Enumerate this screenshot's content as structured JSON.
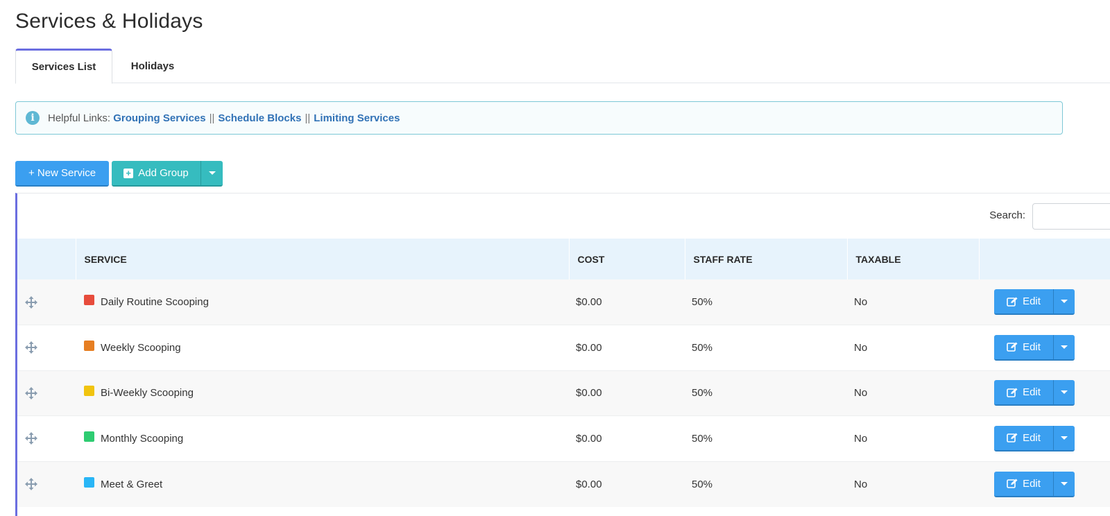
{
  "page": {
    "title": "Services & Holidays"
  },
  "tabs": [
    {
      "label": "Services List",
      "active": true
    },
    {
      "label": "Holidays",
      "active": false
    }
  ],
  "alert": {
    "prefix": "Helpful Links:",
    "links": [
      "Grouping Services",
      "Schedule Blocks",
      "Limiting Services"
    ],
    "separator": "||"
  },
  "toolbar": {
    "new_service_label": "+ New Service",
    "add_group_label": "Add Group"
  },
  "search": {
    "label": "Search:",
    "value": ""
  },
  "table": {
    "headers": [
      "",
      "SERVICE",
      "COST",
      "STAFF RATE",
      "TAXABLE",
      ""
    ],
    "rows": [
      {
        "name": "Daily Routine Scooping",
        "color": "#e74c3c",
        "cost": "$0.00",
        "staff_rate": "50%",
        "taxable": "No",
        "action": "Edit"
      },
      {
        "name": "Weekly Scooping",
        "color": "#e67e22",
        "cost": "$0.00",
        "staff_rate": "50%",
        "taxable": "No",
        "action": "Edit"
      },
      {
        "name": "Bi-Weekly Scooping",
        "color": "#f1c40f",
        "cost": "$0.00",
        "staff_rate": "50%",
        "taxable": "No",
        "action": "Edit"
      },
      {
        "name": "Monthly Scooping",
        "color": "#2ecc71",
        "cost": "$0.00",
        "staff_rate": "50%",
        "taxable": "No",
        "action": "Edit"
      },
      {
        "name": "Meet & Greet",
        "color": "#29b6f6",
        "cost": "$0.00",
        "staff_rate": "50%",
        "taxable": "No",
        "action": "Edit"
      }
    ]
  },
  "colors": {
    "accent": "#6b6ee0",
    "primary": "#3b9ff0",
    "teal": "#36bcbf",
    "link": "#3172b6"
  }
}
